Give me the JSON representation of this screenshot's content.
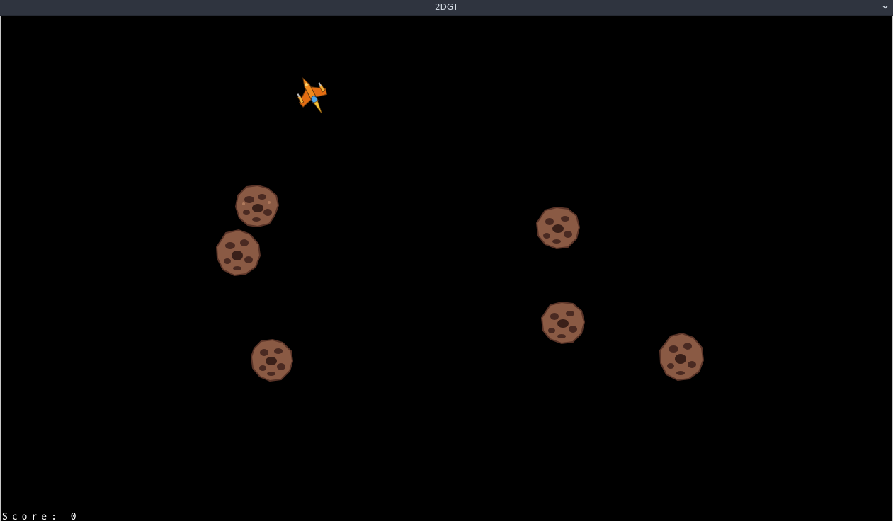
{
  "window": {
    "title": "2DGT"
  },
  "hud": {
    "score_label": "Score:",
    "score_value": "0"
  },
  "sprites": {
    "player": "spaceship-icon",
    "enemy": "asteroid-icon"
  },
  "colors": {
    "background": "#000000",
    "titlebar": "#2f343f",
    "asteroid": "#7a4a3a",
    "ship_body": "#e07a1c"
  }
}
